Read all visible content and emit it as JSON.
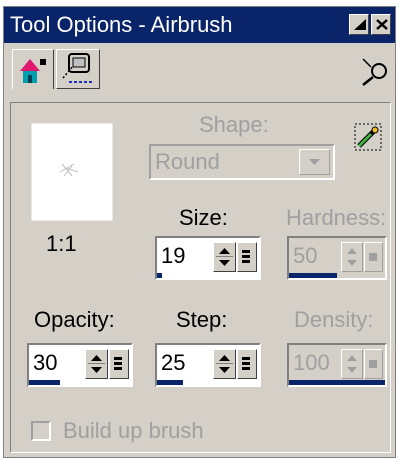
{
  "window": {
    "title": "Tool Options - Airbrush"
  },
  "titlebar_buttons": [
    {
      "name": "auto-hide-button",
      "icon": "auto-hide-icon"
    },
    {
      "name": "close-button",
      "icon": "close-icon"
    }
  ],
  "tabs": [
    {
      "name": "tab-tool-options",
      "icon": "airbrush-tool-icon",
      "active": true
    },
    {
      "name": "tab-tablet-options",
      "icon": "tablet-icon",
      "active": false
    }
  ],
  "brush": {
    "preview_label": "1:1"
  },
  "shape": {
    "label": "Shape:",
    "value": "Round",
    "enabled": false
  },
  "size": {
    "label": "Size:",
    "value": "19",
    "level": 0.05
  },
  "hardness": {
    "label": "Hardness:",
    "value": "50",
    "level": 0.5,
    "enabled": false
  },
  "opacity": {
    "label": "Opacity:",
    "value": "30",
    "level": 0.3
  },
  "step": {
    "label": "Step:",
    "value": "25",
    "level": 0.25
  },
  "density": {
    "label": "Density:",
    "value": "100",
    "level": 1.0,
    "enabled": false
  },
  "build_up": {
    "label": "Build up brush",
    "checked": false,
    "enabled": false
  },
  "colors": {
    "titlebar": "#0a246a",
    "face": "#d4d0c8",
    "disabled_text": "#a0a0a0",
    "meter": "#0a246a"
  }
}
